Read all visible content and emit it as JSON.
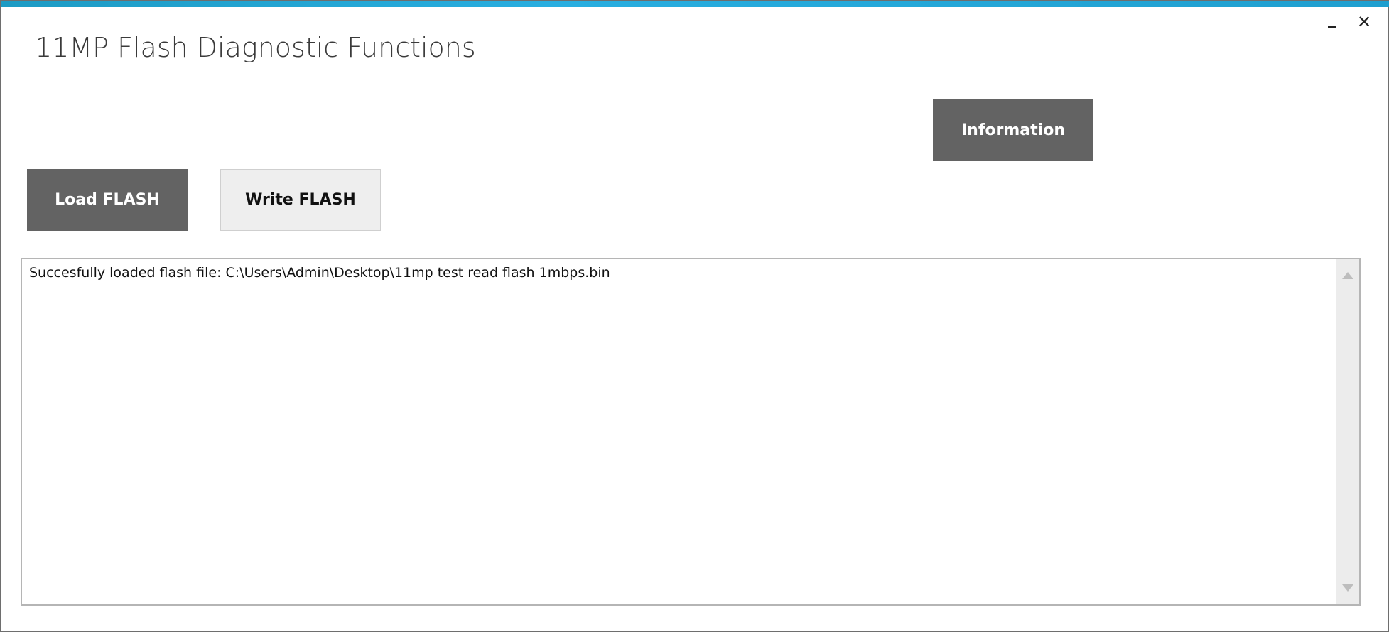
{
  "window": {
    "title": "11MP Flash Diagnostic Functions",
    "close_glyph": "✕",
    "accent_color": "#29aee0"
  },
  "toolbar": {
    "information_label": "Information",
    "load_label": "Load FLASH",
    "write_label": "Write FLASH"
  },
  "log": {
    "text": "Succesfully loaded flash file: C:\\Users\\Admin\\Desktop\\11mp test read flash 1mbps.bin"
  },
  "icons": {
    "minimize": "minimize-icon",
    "close": "close-icon",
    "scroll_up": "scroll-up-arrow-icon",
    "scroll_down": "scroll-down-arrow-icon"
  }
}
